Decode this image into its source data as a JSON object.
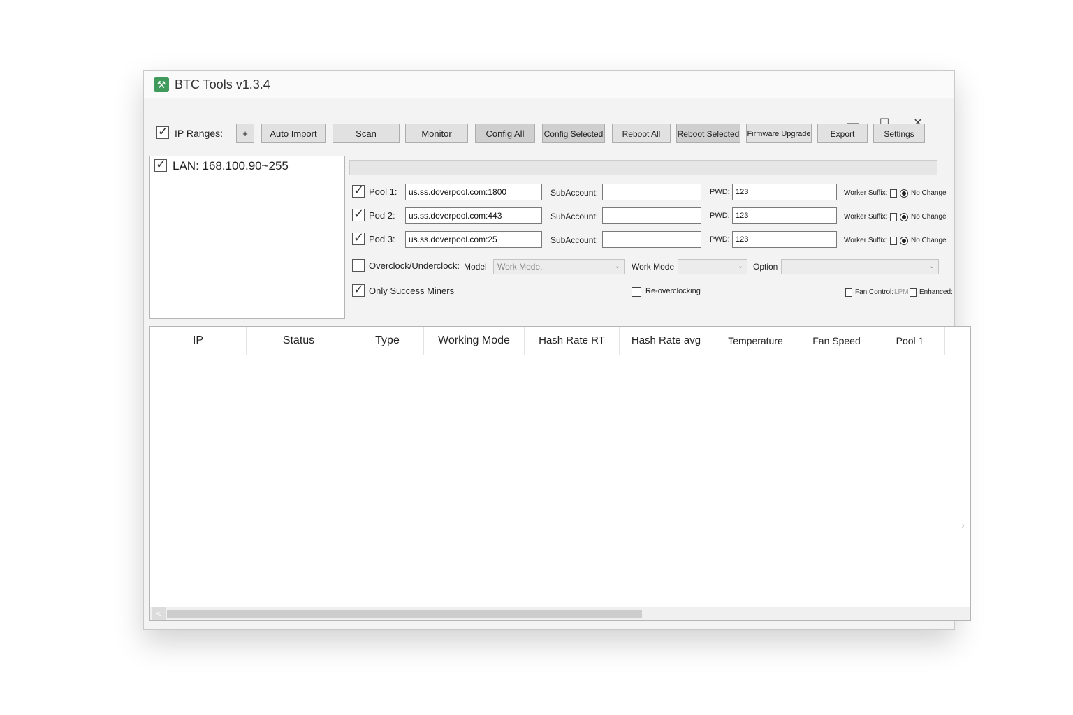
{
  "window": {
    "title": "BTC Tools v1.3.4",
    "controls": {
      "minimize": "—",
      "maximize": "☐",
      "close": "✕"
    }
  },
  "toolbar": {
    "ip_ranges_label": "IP Ranges:",
    "ip_ranges_checked": true,
    "add_label": "+",
    "buttons": [
      "Auto Import",
      "Scan",
      "Monitor",
      "Config All",
      "Config Selected",
      "Reboot All",
      "Reboot Selected",
      "Firmware Upgrade",
      "Export",
      "Settings"
    ]
  },
  "ip_list": {
    "items": [
      {
        "label": "LAN: 168.100.90~255",
        "checked": true
      }
    ]
  },
  "pools": [
    {
      "label": "Pool 1:",
      "checked": true,
      "url": "us.ss.doverpool.com:1800",
      "subaccount_label": "SubAccount:",
      "subaccount": "",
      "pwd_label": "PWD:",
      "pwd": "123",
      "worker_suffix_label": "Worker Suffix:",
      "no_change_label": "No Change"
    },
    {
      "label": "Pod 2:",
      "checked": true,
      "url": "us.ss.doverpool.com:443",
      "subaccount_label": "SubAccount:",
      "subaccount": "",
      "pwd_label": "PWD:",
      "pwd": "123",
      "worker_suffix_label": "Worker Suffix:",
      "no_change_label": "No Change"
    },
    {
      "label": "Pod 3:",
      "checked": true,
      "url": "us.ss.doverpool.com:25",
      "subaccount_label": "SubAccount:",
      "subaccount": "",
      "pwd_label": "PWD:",
      "pwd": "123",
      "worker_suffix_label": "Worker Suffix:",
      "no_change_label": "No Change"
    }
  ],
  "overclock": {
    "label": "Overclock/Underclock:",
    "checked": false,
    "model_label": "Model",
    "model_value": "Work Mode.",
    "work_mode_label": "Work Mode",
    "work_mode_value": "",
    "option_label": "Option",
    "option_value": ""
  },
  "filters": {
    "only_success_label": "Only Success Miners",
    "only_success_checked": true,
    "re_overclocking_label": "Re-overclocking",
    "re_overclocking_checked": false,
    "fan_control_label": "Fan Control:",
    "fan_control_unit": "LPM",
    "enhanced_label": "Enhanced:"
  },
  "table": {
    "columns": [
      "IP",
      "Status",
      "Type",
      "Working Mode",
      "Hash Rate RT",
      "Hash Rate avg",
      "Temperature",
      "Fan Speed",
      "Pool 1"
    ],
    "rows": []
  },
  "scroll": {
    "right_arrow": "›",
    "left_arrow": "<"
  }
}
